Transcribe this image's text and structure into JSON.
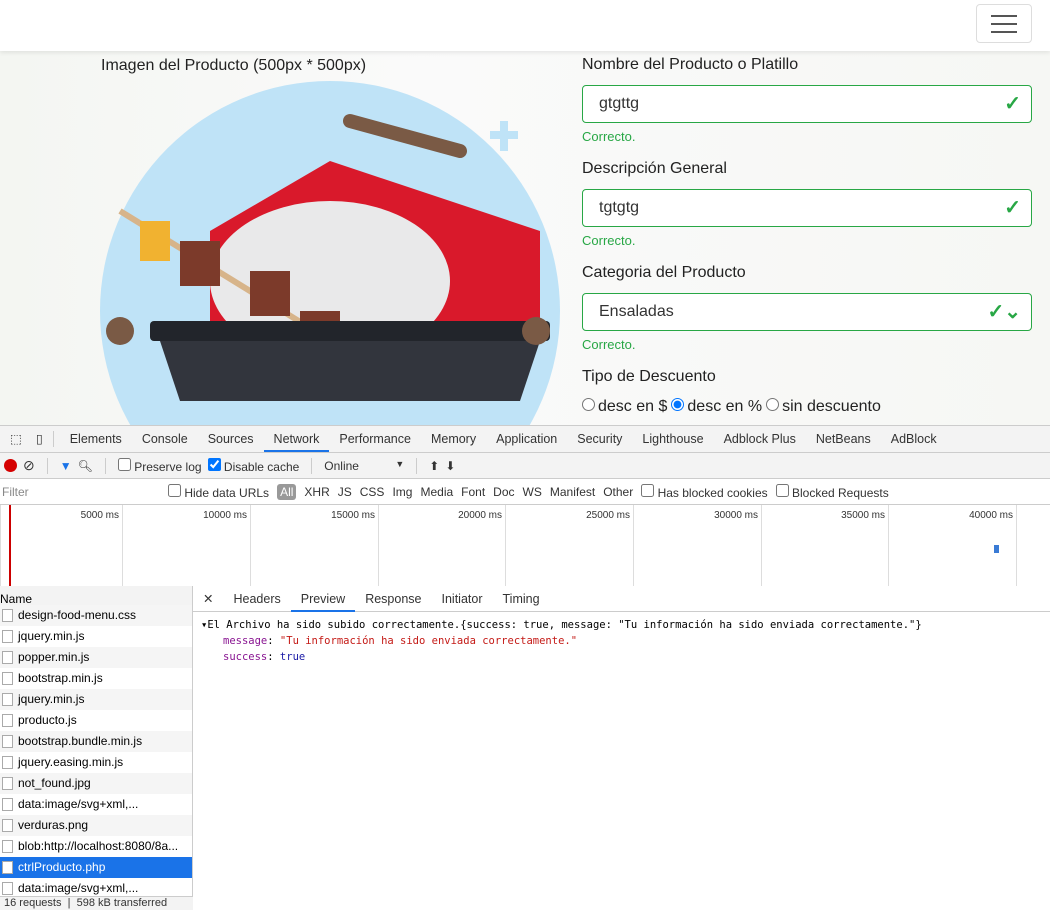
{
  "navbar": {
    "menu_icon": "hamburger-icon"
  },
  "form": {
    "image_label": "Imagen del Producto (500px * 500px)",
    "name_label": "Nombre del Producto o Platillo",
    "name_value": "gtgttg",
    "desc_label": "Descripción General",
    "desc_value": "tgtgtg",
    "cat_label": "Categoria del Producto",
    "cat_value": "Ensaladas",
    "valid_text": "Correcto.",
    "discount_label": "Tipo de Descuento",
    "discount_options": [
      "desc en $",
      "desc en %",
      "sin descuento"
    ],
    "discount_selected": "desc en %",
    "valid_color": "#28a745"
  },
  "devtools": {
    "tabs": [
      "Elements",
      "Console",
      "Sources",
      "Network",
      "Performance",
      "Memory",
      "Application",
      "Security",
      "Lighthouse",
      "Adblock Plus",
      "NetBeans",
      "AdBlock"
    ],
    "active_tab": "Network",
    "toolbar": {
      "preserve_log": "Preserve log",
      "disable_cache": "Disable cache",
      "throttle": "Online"
    },
    "filter": {
      "placeholder": "Filter",
      "hide_data_urls": "Hide data URLs",
      "types": [
        "All",
        "XHR",
        "JS",
        "CSS",
        "Img",
        "Media",
        "Font",
        "Doc",
        "WS",
        "Manifest",
        "Other"
      ],
      "blocked_cookies": "Has blocked cookies",
      "blocked_requests": "Blocked Requests"
    },
    "timeline_ticks": [
      "5000 ms",
      "10000 ms",
      "15000 ms",
      "20000 ms",
      "25000 ms",
      "30000 ms",
      "35000 ms",
      "40000 ms"
    ],
    "name_header": "Name",
    "requests": [
      "design-food-menu.css",
      "jquery.min.js",
      "popper.min.js",
      "bootstrap.min.js",
      "jquery.min.js",
      "producto.js",
      "bootstrap.bundle.min.js",
      "jquery.easing.min.js",
      "not_found.jpg",
      "data:image/svg+xml,...",
      "verduras.png",
      "blob:http://localhost:8080/8a...",
      "ctrlProducto.php",
      "data:image/svg+xml,..."
    ],
    "selected_request": "ctrlProducto.php",
    "status": {
      "requests": "16 requests",
      "transferred": "598 kB transferred"
    },
    "detail_tabs": [
      "Headers",
      "Preview",
      "Response",
      "Initiator",
      "Timing"
    ],
    "active_detail_tab": "Preview",
    "preview": {
      "summary": "El Archivo ha sido subido correctamente.{success: true, message: \"Tu información ha sido enviada correctamente.\"}",
      "message_key": "message",
      "message_value": "\"Tu información ha sido enviada correctamente.\"",
      "success_key": "success",
      "success_value": "true"
    }
  }
}
